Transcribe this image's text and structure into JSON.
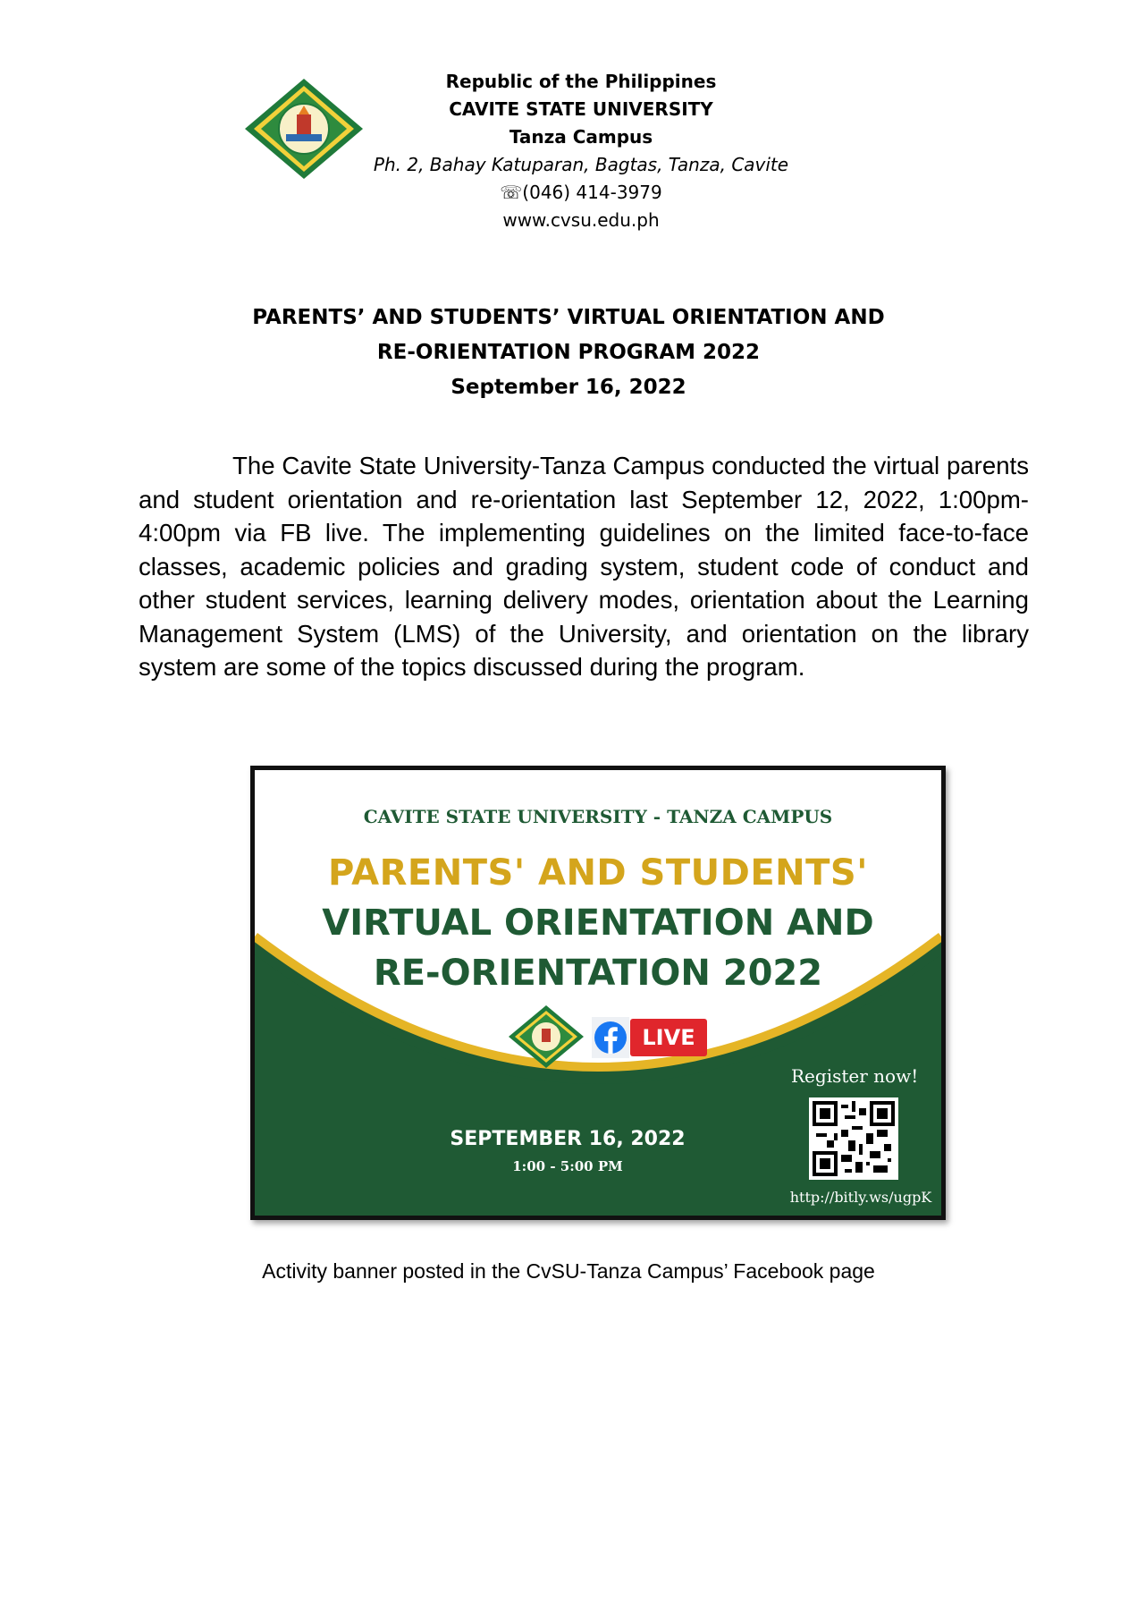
{
  "letterhead": {
    "line1": "Republic of the Philippines",
    "line2": "CAVITE STATE UNIVERSITY",
    "line3": "Tanza Campus",
    "line4": "Ph. 2, Bahay Katuparan, Bagtas, Tanza, Cavite",
    "phone": "☏(046) 414-3979",
    "website": "www.cvsu.edu.ph"
  },
  "title": {
    "line1": "PARENTS’ AND STUDENTS’ VIRTUAL ORIENTATION AND",
    "line2": "RE-ORIENTATION PROGRAM 2022",
    "date": "September 16, 2022"
  },
  "body": {
    "paragraph": "The Cavite State University-Tanza Campus conducted the virtual parents and student orientation and re-orientation last September 12, 2022, 1:00pm-4:00pm via FB live. The implementing guidelines on the limited face-to-face classes, academic policies and grading system, student code of conduct and other student services, learning delivery modes, orientation about the Learning Management System (LMS) of the University, and orientation on the library system are some of the topics discussed during the program."
  },
  "banner": {
    "university": "CAVITE STATE UNIVERSITY - TANZA CAMPUS",
    "title1": "PARENTS' AND STUDENTS'",
    "title2": "VIRTUAL ORIENTATION AND",
    "title3": "RE-ORIENTATION 2022",
    "live": "LIVE",
    "register": "Register now!",
    "date": "SEPTEMBER 16, 2022",
    "time": "1:00 - 5:00 PM",
    "url": "http://bitly.ws/ugpK",
    "colors": {
      "green": "#1f5a34",
      "gold": "#d4a51c",
      "live_red": "#e0262c",
      "facebook_blue": "#1877f2"
    }
  },
  "caption": "Activity banner posted in the CvSU-Tanza Campus’ Facebook page"
}
